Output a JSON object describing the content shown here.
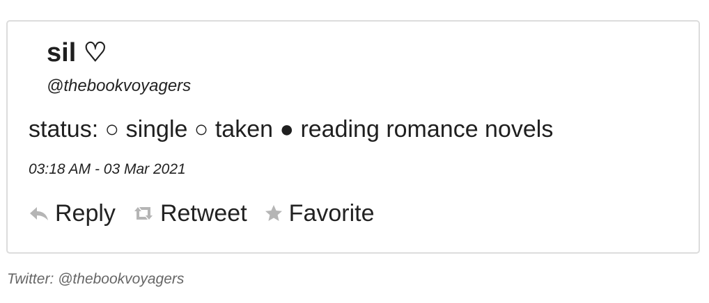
{
  "tweet": {
    "display_name": "sil ♡",
    "handle": "@thebookvoyagers",
    "text": "status: ○ single ○ taken ● reading romance novels",
    "timestamp": "03:18 AM - 03 Mar 2021"
  },
  "actions": {
    "reply": {
      "label": "Reply",
      "icon": "reply-icon"
    },
    "retweet": {
      "label": "Retweet",
      "icon": "retweet-icon"
    },
    "favorite": {
      "label": "Favorite",
      "icon": "star-icon"
    }
  },
  "footer": {
    "credit": "Twitter: @thebookvoyagers"
  },
  "colors": {
    "icon_gray": "#b5b5b5",
    "border": "#dcdcdc",
    "text": "#1f1f1f",
    "credit": "#666666"
  }
}
